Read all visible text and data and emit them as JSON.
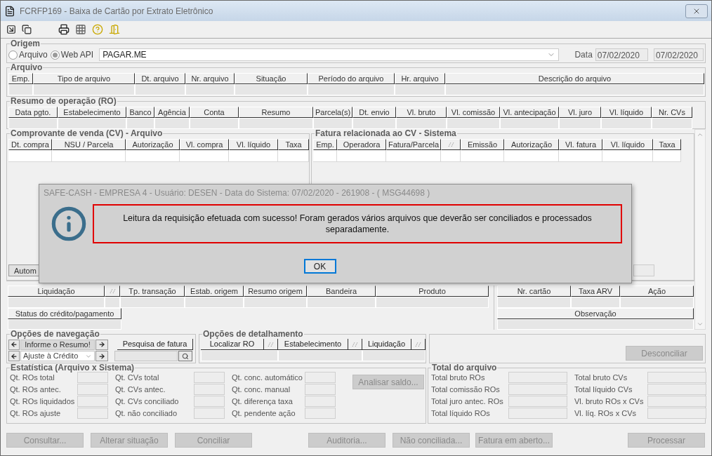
{
  "window": {
    "title": "FCRFP169 - Baixa de Cartão por Extrato Eletrônico"
  },
  "origem": {
    "title": "Origem",
    "options": [
      {
        "label": "Arquivo",
        "selected": false
      },
      {
        "label": "Web API",
        "selected": true
      }
    ],
    "source": "PAGAR.ME",
    "date_label": "Data",
    "date_from": "07/02/2020",
    "date_to": "07/02/2020"
  },
  "arquivo": {
    "title": "Arquivo",
    "columns": [
      {
        "kind": "text",
        "label": "Emp."
      },
      {
        "kind": "text",
        "label": "Tipo de arquivo"
      },
      {
        "kind": "text",
        "label": "Dt. arquivo"
      },
      {
        "kind": "text",
        "label": "Nr. arquivo"
      },
      {
        "kind": "text",
        "label": "Situação"
      },
      {
        "kind": "text",
        "label": "Período do arquivo"
      },
      {
        "kind": "text",
        "label": "Hr. arquivo"
      },
      {
        "kind": "text",
        "label": "Descrição do arquivo"
      }
    ]
  },
  "resumo": {
    "title": "Resumo de operação (RO)",
    "columns": [
      {
        "kind": "text",
        "label": "Data pgto."
      },
      {
        "kind": "text",
        "label": "Estabelecimento"
      },
      {
        "kind": "text",
        "label": "Banco"
      },
      {
        "kind": "text",
        "label": "Agência"
      },
      {
        "kind": "text",
        "label": "Conta"
      },
      {
        "kind": "text",
        "label": "Resumo"
      },
      {
        "kind": "text",
        "label": "Parcela(s)"
      },
      {
        "kind": "text",
        "label": "Dt. envio"
      },
      {
        "kind": "text",
        "label": "Vl. bruto"
      },
      {
        "kind": "text",
        "label": "Vl. comissão"
      },
      {
        "kind": "text",
        "label": "Vl. antecipação"
      },
      {
        "kind": "text",
        "label": "Vl. juro"
      },
      {
        "kind": "text",
        "label": "Vl. líquido"
      },
      {
        "kind": "text",
        "label": "Nr. CVs"
      }
    ]
  },
  "comprovante": {
    "title": "Comprovante de venda (CV) - Arquivo",
    "columns": [
      {
        "kind": "text",
        "label": "Dt. compra"
      },
      {
        "kind": "text",
        "label": "NSU / Parcela"
      },
      {
        "kind": "text",
        "label": "Autorização"
      },
      {
        "kind": "text",
        "label": "Vl. compra"
      },
      {
        "kind": "text",
        "label": "Vl. líquido"
      },
      {
        "kind": "text",
        "label": "Taxa"
      }
    ],
    "button": "Autom"
  },
  "fatura": {
    "title": "Fatura relacionada ao CV - Sistema",
    "columns": [
      {
        "kind": "text",
        "label": "Emp."
      },
      {
        "kind": "text",
        "label": "Operadora"
      },
      {
        "kind": "text",
        "label": "Fatura/Parcela"
      },
      {
        "kind": "toggle"
      },
      {
        "kind": "text",
        "label": "Emissão"
      },
      {
        "kind": "text",
        "label": "Autorização"
      },
      {
        "kind": "text",
        "label": "Vl. fatura"
      },
      {
        "kind": "text",
        "label": "Vl. líquido"
      },
      {
        "kind": "text",
        "label": "Taxa"
      }
    ]
  },
  "detalhe": {
    "columns": [
      {
        "kind": "text",
        "label": "Liquidação"
      },
      {
        "kind": "toggle"
      },
      {
        "kind": "text",
        "label": "Tp. transação"
      },
      {
        "kind": "text",
        "label": "Estab. origem"
      },
      {
        "kind": "text",
        "label": "Resumo origem"
      },
      {
        "kind": "text",
        "label": "Bandeira"
      },
      {
        "kind": "text",
        "label": "Produto"
      }
    ],
    "status": "Status do crédito/pagamento",
    "right_columns": [
      {
        "kind": "text",
        "label": "Nr. cartão"
      },
      {
        "kind": "text",
        "label": "Taxa ARV"
      },
      {
        "kind": "text",
        "label": "Ação"
      }
    ],
    "observacao": "Observação"
  },
  "navegacao": {
    "title": "Opções de navegação",
    "prompt": "Informe o Resumo!",
    "select": "Ajuste à Crédito",
    "search": "Pesquisa de fatura"
  },
  "detalhamento": {
    "title": "Opções de detalhamento",
    "buttons": [
      "Localizar RO",
      "Estabelecimento",
      "Liquidação"
    ]
  },
  "desconciliar": {
    "label": "Desconciliar",
    "disabled": true
  },
  "estatistica": {
    "title": "Estatística (Arquivo x Sistema)",
    "groups": [
      [
        "Qt. ROs total",
        "Qt. ROs antec.",
        "Qt. ROs liquidados",
        "Qt. ROs ajuste"
      ],
      [
        "Qt. CVs total",
        "Qt. CVs antec.",
        "Qt. CVs conciliado",
        "Qt. não conciliado"
      ],
      [
        "Qt. conc. automático",
        "Qt. conc. manual",
        "Qt. diferença taxa",
        "Qt. pendente ação"
      ]
    ],
    "button": {
      "label": "Analisar saldo...",
      "disabled": true
    }
  },
  "total": {
    "title": "Total do arquivo",
    "groups": [
      [
        "Total bruto ROs",
        "Total comissão ROs",
        "Total juro antec. ROs",
        "Total líquido ROs"
      ],
      [
        "Total bruto CVs",
        "Total líquido CVs",
        "Vl. bruto ROs x CVs",
        "Vl. líq. ROs x CVs"
      ]
    ]
  },
  "actions": [
    {
      "label": "Consultar...",
      "disabled": true
    },
    {
      "label": "Alterar situação",
      "disabled": true
    },
    {
      "label": "Conciliar",
      "disabled": true
    },
    {
      "label": "Auditoria...",
      "disabled": true
    },
    {
      "label": "Não conciliada...",
      "disabled": true
    },
    {
      "label": "Fatura em aberto...",
      "disabled": true
    },
    {
      "label": "Processar",
      "disabled": true
    }
  ],
  "dialog": {
    "title": "SAFE-CASH - EMPRESA 4 - Usuário: DESEN - Data do Sistema: 07/02/2020 - 261908 - ( MSG44698 )",
    "message": "Leitura da requisição efetuada com sucesso! Foram gerados vários arquivos que deverão ser conciliados e processados separadamente.",
    "ok": "OK"
  }
}
